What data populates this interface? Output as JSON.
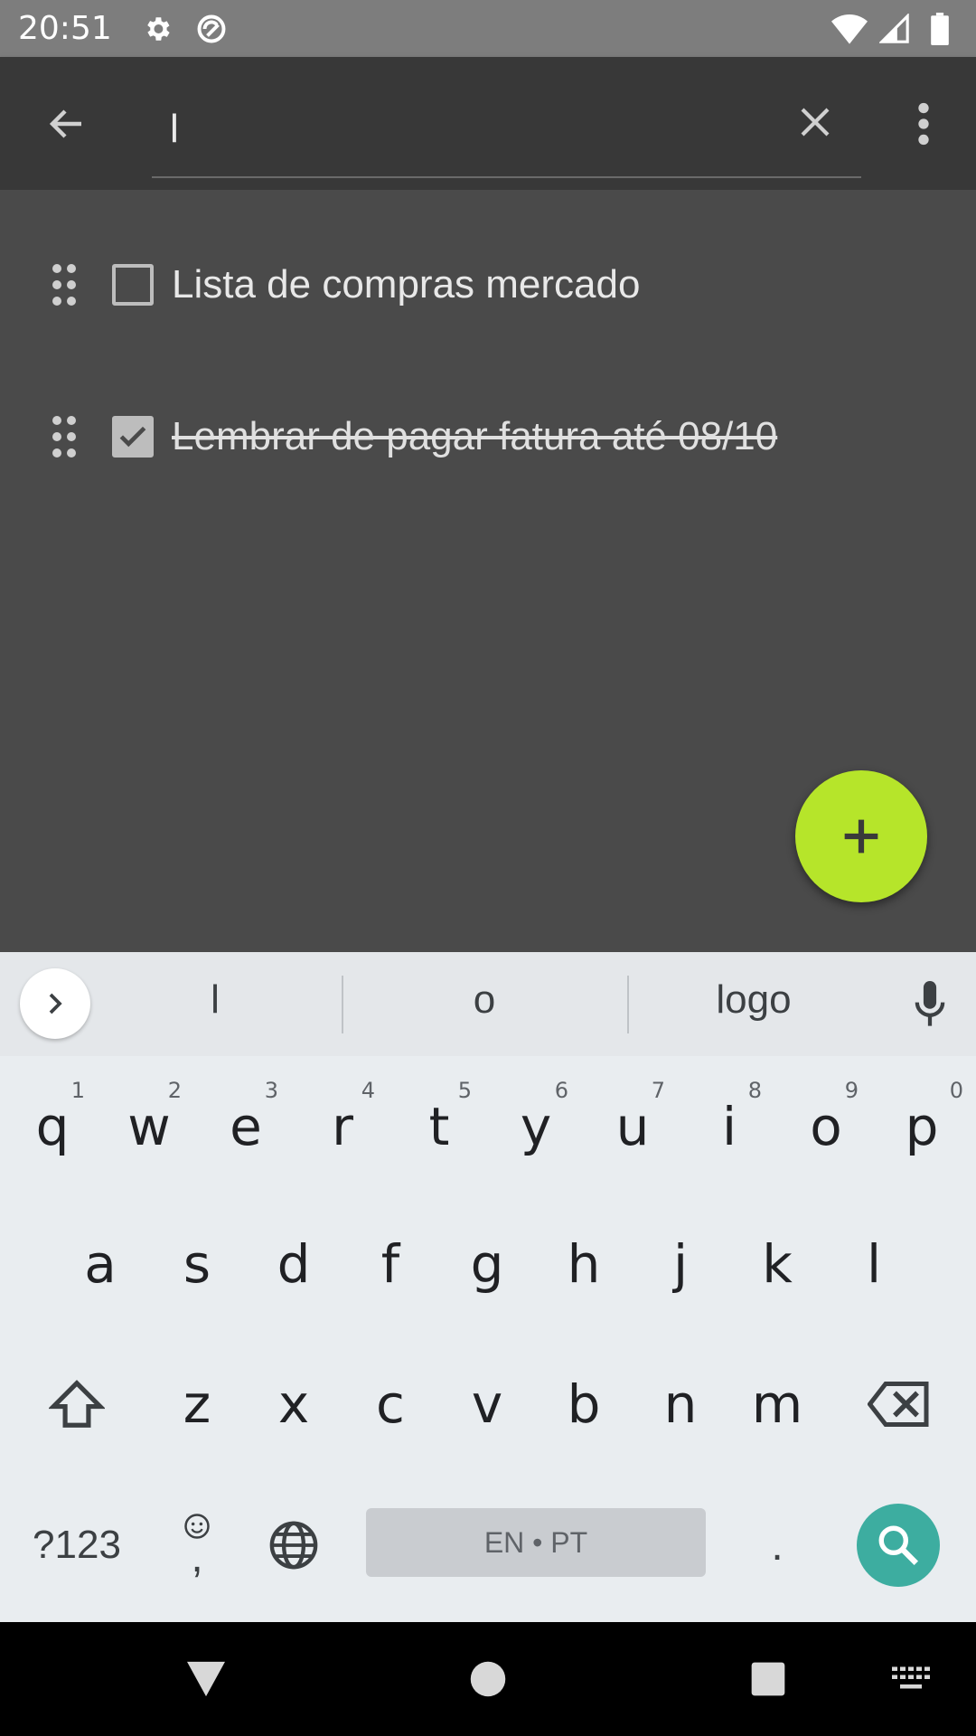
{
  "status_bar": {
    "time": "20:51",
    "icons": [
      "settings-icon",
      "sync-icon",
      "wifi-icon",
      "signal-icon",
      "battery-icon"
    ]
  },
  "toolbar": {
    "search_value": "l",
    "search_placeholder": ""
  },
  "list": {
    "items": [
      {
        "label": "Lista de compras mercado",
        "checked": false
      },
      {
        "label": "Lembrar de pagar fatura até 08/10",
        "checked": true
      }
    ]
  },
  "fab": {
    "label": "+",
    "color": "#b6e52a"
  },
  "keyboard": {
    "suggestions": [
      "l",
      "o",
      "logo"
    ],
    "row1": [
      "q",
      "w",
      "e",
      "r",
      "t",
      "y",
      "u",
      "i",
      "o",
      "p"
    ],
    "row1_hints": [
      "1",
      "2",
      "3",
      "4",
      "5",
      "6",
      "7",
      "8",
      "9",
      "0"
    ],
    "row2": [
      "a",
      "s",
      "d",
      "f",
      "g",
      "h",
      "j",
      "k",
      "l"
    ],
    "row3": [
      "z",
      "x",
      "c",
      "v",
      "b",
      "n",
      "m"
    ],
    "symbols_label": "?123",
    "comma_label": ",",
    "space_label": "EN • PT",
    "period_label": ".",
    "accent_color": "#3dada0"
  }
}
